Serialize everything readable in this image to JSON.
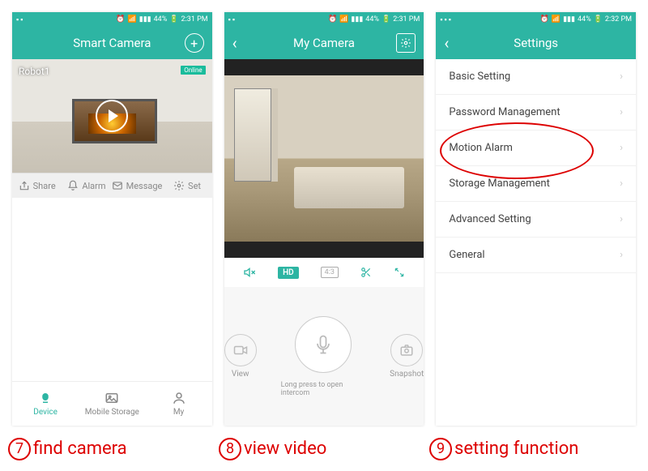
{
  "status": {
    "battery": "44%",
    "time": "2:31 PM",
    "time_alt": "2:32 PM"
  },
  "screen1": {
    "title": "Smart Camera",
    "camera_name": "Robot1",
    "online": "Online",
    "actions": {
      "share": "Share",
      "alarm": "Alarm",
      "message": "Message",
      "set": "Set"
    },
    "nav": {
      "device": "Device",
      "storage": "Mobile Storage",
      "my": "My"
    }
  },
  "screen2": {
    "title": "My Camera",
    "hd": "HD",
    "ratio": "4:3",
    "view": "View",
    "snapshot": "Snapshot",
    "hint": "Long press to open intercom"
  },
  "screen3": {
    "title": "Settings",
    "items": [
      "Basic Setting",
      "Password Management",
      "Motion Alarm",
      "Storage Management",
      "Advanced Setting",
      "General"
    ]
  },
  "captions": {
    "c7_num": "7",
    "c7": "find camera",
    "c8_num": "8",
    "c8": "view video",
    "c9_num": "9",
    "c9": "setting function"
  }
}
